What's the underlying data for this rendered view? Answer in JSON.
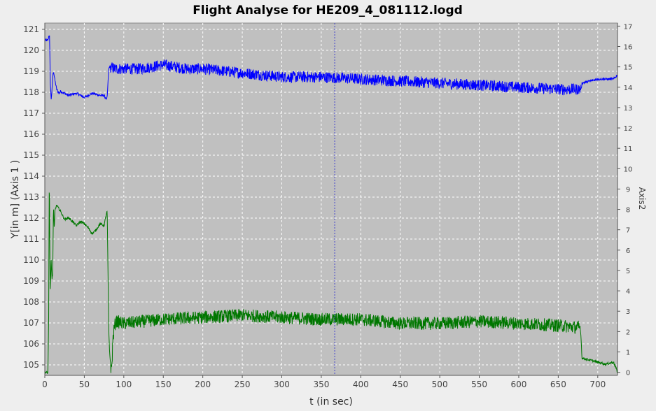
{
  "chart_data": {
    "type": "line",
    "title": "Flight Analyse for HE209_4_081112.logd",
    "xlabel": "t (in sec)",
    "ylabel": "Y[in m] (Axis 1 )",
    "y2label": "Axis2",
    "xlim": [
      0,
      725
    ],
    "ylim": [
      104.5,
      121.3
    ],
    "y2lim": [
      -0.15,
      17.15
    ],
    "xticks": [
      0,
      50,
      100,
      150,
      200,
      250,
      300,
      350,
      400,
      450,
      500,
      550,
      600,
      650,
      700
    ],
    "yticks": [
      105,
      106,
      107,
      108,
      109,
      110,
      111,
      112,
      113,
      114,
      115,
      116,
      117,
      118,
      119,
      120,
      121
    ],
    "y2ticks": [
      0,
      1,
      2,
      3,
      4,
      5,
      6,
      7,
      8,
      9,
      10,
      11,
      12,
      13,
      14,
      15,
      16,
      17
    ],
    "grid": true,
    "crosshair_x": 367,
    "colors": {
      "plot_bg": "#c0c0c0",
      "page_bg": "#eeeeee",
      "grid": "#ffffff",
      "crosshair": "#4444cc"
    },
    "series": [
      {
        "axis": "right",
        "color": "#0000ff",
        "noise": 0.28,
        "x": [
          0,
          4,
          5,
          6,
          7,
          8,
          9,
          10,
          11,
          13,
          15,
          18,
          20,
          30,
          40,
          50,
          60,
          70,
          75,
          78,
          79,
          80,
          81,
          82,
          90,
          100,
          120,
          150,
          180,
          200,
          250,
          300,
          350,
          400,
          450,
          500,
          550,
          600,
          650,
          678,
          679,
          680,
          690,
          700,
          710,
          720,
          725
        ],
        "y": [
          16.3,
          16.3,
          16.5,
          16.5,
          14.2,
          13.4,
          13.8,
          14.5,
          14.8,
          14.3,
          13.9,
          13.7,
          13.8,
          13.6,
          13.7,
          13.5,
          13.7,
          13.6,
          13.6,
          13.4,
          13.5,
          14.2,
          14.9,
          15.0,
          14.9,
          14.9,
          14.9,
          15.1,
          14.9,
          14.9,
          14.7,
          14.5,
          14.5,
          14.4,
          14.3,
          14.2,
          14.1,
          14.0,
          13.9,
          13.9,
          13.9,
          14.2,
          14.3,
          14.4,
          14.4,
          14.4,
          14.6
        ]
      },
      {
        "axis": "right",
        "color": "#007700",
        "noise": 0.32,
        "x": [
          0,
          4,
          5,
          5.5,
          6,
          6.5,
          7,
          8,
          9,
          10,
          11,
          12,
          13,
          15,
          20,
          25,
          30,
          35,
          40,
          45,
          50,
          55,
          60,
          65,
          70,
          75,
          78,
          79,
          80,
          81,
          82,
          84,
          85,
          86,
          88,
          90,
          100,
          150,
          200,
          250,
          300,
          350,
          400,
          450,
          500,
          550,
          600,
          650,
          675,
          678,
          679,
          680,
          690,
          700,
          710,
          720,
          725
        ],
        "y": [
          0.0,
          0.0,
          3.0,
          8.9,
          8.6,
          5.0,
          4.1,
          5.5,
          4.6,
          4.8,
          8.2,
          7.0,
          8.0,
          8.2,
          7.9,
          7.5,
          7.6,
          7.4,
          7.2,
          7.4,
          7.3,
          7.1,
          6.8,
          7.0,
          7.3,
          7.2,
          7.8,
          7.9,
          5.0,
          2.0,
          1.0,
          0.1,
          0.4,
          1.5,
          2.2,
          2.5,
          2.4,
          2.6,
          2.7,
          2.8,
          2.7,
          2.6,
          2.6,
          2.4,
          2.4,
          2.5,
          2.4,
          2.3,
          2.2,
          2.2,
          1.6,
          0.7,
          0.6,
          0.5,
          0.4,
          0.5,
          0.0
        ]
      }
    ]
  }
}
